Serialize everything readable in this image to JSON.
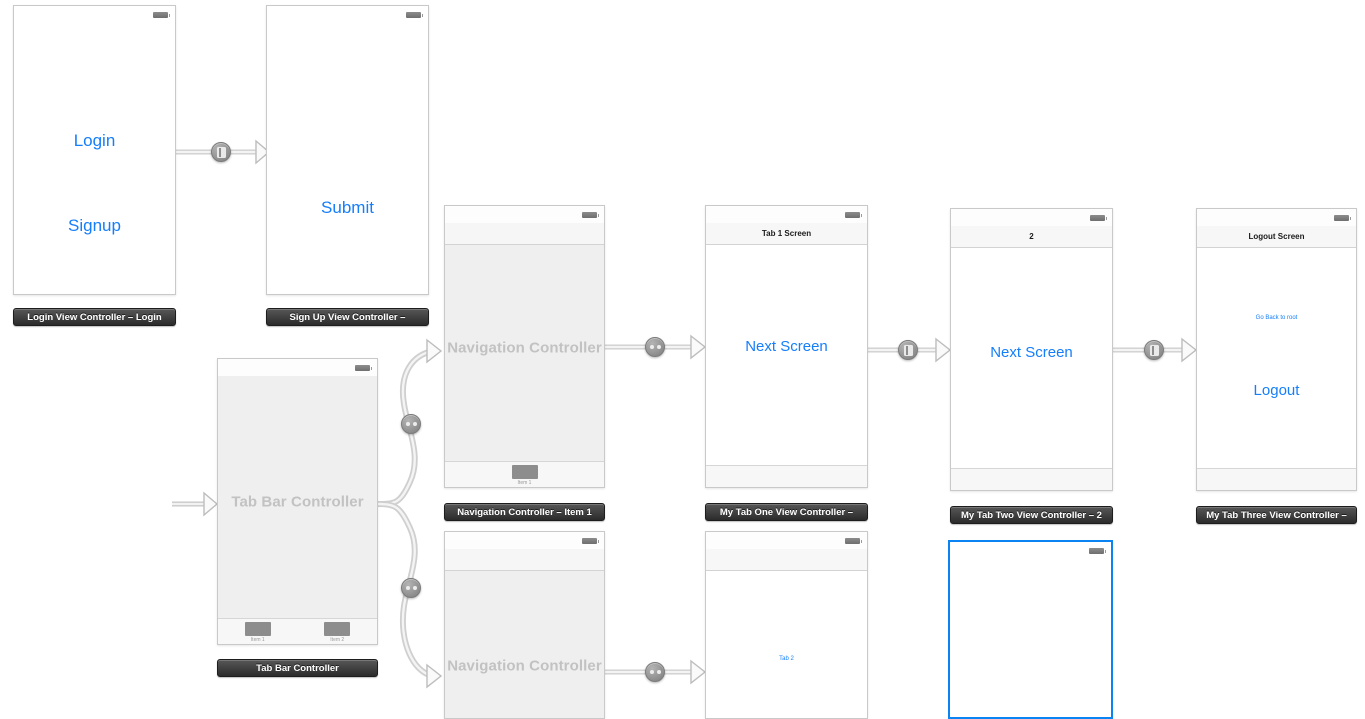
{
  "editor": {
    "kind": "storyboard-canvas",
    "background": "#ffffff",
    "accent": "#157efb",
    "selection_color": "#0b84f3"
  },
  "scenes": [
    {
      "id": "login",
      "plaque": "Login View Controller – Login",
      "nav_title": null,
      "labels": [
        {
          "text": "Login",
          "size": 17
        },
        {
          "text": "Signup",
          "size": 17
        }
      ],
      "placeholder": null,
      "tab_items": [],
      "selected": false
    },
    {
      "id": "signup",
      "plaque": "Sign Up View Controller –",
      "nav_title": null,
      "labels": [
        {
          "text": "Submit",
          "size": 17
        }
      ],
      "placeholder": null,
      "tab_items": [],
      "selected": false
    },
    {
      "id": "tab-bar-controller",
      "plaque": "Tab Bar Controller",
      "nav_title": null,
      "labels": [],
      "placeholder": "Tab Bar Controller",
      "tab_items": [
        {
          "label": "Item 1"
        },
        {
          "label": "Item 2"
        }
      ],
      "selected": false
    },
    {
      "id": "nav-controller-item1",
      "plaque": "Navigation Controller – Item 1",
      "nav_title": null,
      "labels": [],
      "placeholder": "Navigation Controller",
      "tab_items": [
        {
          "label": "Item 1"
        }
      ],
      "selected": false
    },
    {
      "id": "nav-controller-item2",
      "plaque": null,
      "nav_title": null,
      "labels": [],
      "placeholder": "Navigation Controller",
      "tab_items": [],
      "selected": false
    },
    {
      "id": "my-tab-one",
      "plaque": "My Tab One View Controller –",
      "nav_title": "Tab 1 Screen",
      "labels": [
        {
          "text": "Next Screen",
          "size": 15
        }
      ],
      "placeholder": null,
      "tab_items": [],
      "selected": false
    },
    {
      "id": "my-tab-two",
      "plaque": "My Tab Two View Controller – 2",
      "nav_title": "2",
      "labels": [
        {
          "text": "Next Screen",
          "size": 15
        }
      ],
      "placeholder": null,
      "tab_items": [],
      "selected": false
    },
    {
      "id": "my-tab-three",
      "plaque": "My Tab Three View Controller –",
      "nav_title": "Logout Screen",
      "labels": [
        {
          "text": "Go Back to root",
          "size": 6
        },
        {
          "text": "Logout",
          "size": 15
        }
      ],
      "placeholder": null,
      "tab_items": [],
      "selected": false
    },
    {
      "id": "tab-two-screen",
      "plaque": null,
      "nav_title": "",
      "labels": [
        {
          "text": "Tab 2",
          "size": 6
        }
      ],
      "placeholder": null,
      "tab_items": [],
      "selected": false
    },
    {
      "id": "selected-scene",
      "plaque": null,
      "nav_title": null,
      "labels": [],
      "placeholder": null,
      "tab_items": [],
      "selected": true
    }
  ],
  "segues": [
    {
      "id": "login-to-signup",
      "kind": "modal",
      "icon": "modal-segue-icon"
    },
    {
      "id": "tab-to-nav1",
      "kind": "relationship",
      "icon": "relationship-segue-icon"
    },
    {
      "id": "tab-to-nav2",
      "kind": "relationship",
      "icon": "relationship-segue-icon"
    },
    {
      "id": "nav1-to-tabone",
      "kind": "relationship",
      "icon": "relationship-segue-icon"
    },
    {
      "id": "tabone-to-tabtwo",
      "kind": "push",
      "icon": "push-segue-icon"
    },
    {
      "id": "tabtwo-to-tabthree",
      "kind": "push",
      "icon": "push-segue-icon"
    },
    {
      "id": "nav2-to-tab2screen",
      "kind": "relationship",
      "icon": "relationship-segue-icon"
    }
  ],
  "entry_point": {
    "name": "initial-view-controller-arrow",
    "target": "tab-bar-controller"
  }
}
